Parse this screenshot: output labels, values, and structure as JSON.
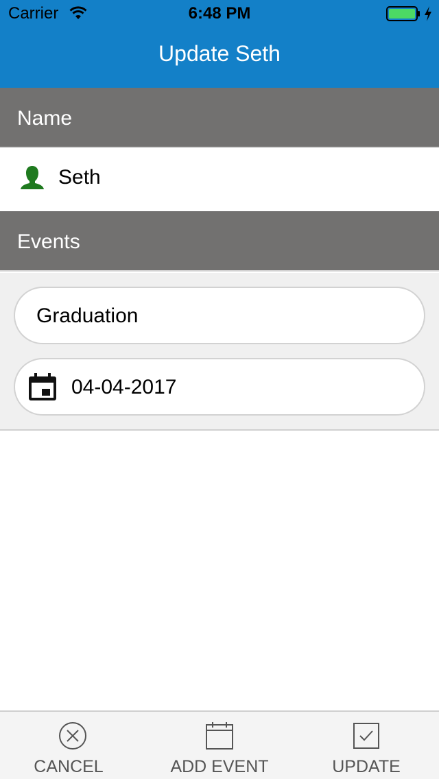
{
  "status_bar": {
    "carrier": "Carrier",
    "time": "6:48 PM",
    "battery_color": "#4cd964"
  },
  "nav": {
    "title": "Update Seth",
    "color": "#1380c8"
  },
  "sections": {
    "name_header": "Name",
    "events_header": "Events",
    "header_color": "#727170"
  },
  "contact": {
    "name": "Seth",
    "icon": "person-icon",
    "icon_color": "#1f7a1f"
  },
  "event": {
    "name": "Graduation",
    "date": "04-04-2017",
    "date_icon": "calendar-icon"
  },
  "tab_bar": {
    "items": [
      {
        "label": "CANCEL",
        "icon": "cancel-circle-icon"
      },
      {
        "label": "ADD EVENT",
        "icon": "calendar-add-icon"
      },
      {
        "label": "UPDATE",
        "icon": "checkbox-icon"
      }
    ]
  }
}
